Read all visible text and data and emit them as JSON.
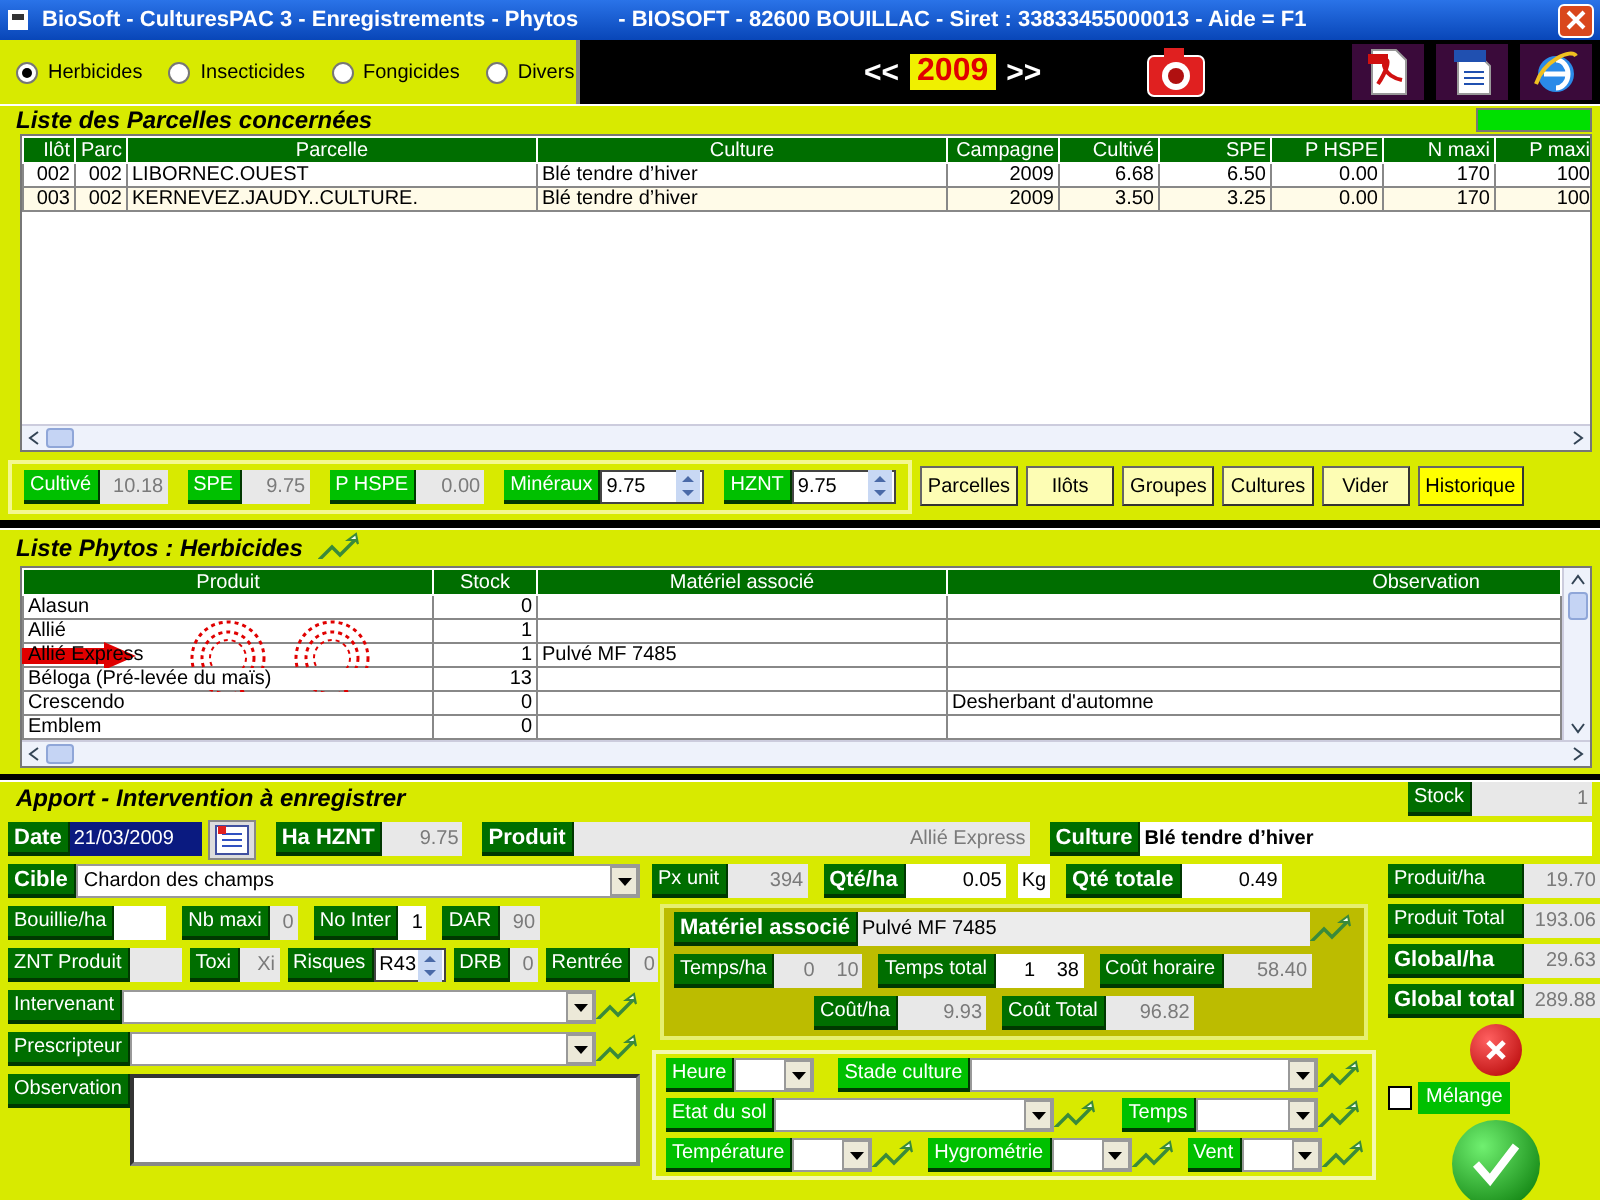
{
  "window": {
    "title": [
      "BioSoft - CulturesPAC 3 - Enregistrements - Phytos",
      "- BIOSOFT - 82600 BOUILLAC - Siret : 33833455000013 - Aide = F1"
    ]
  },
  "filters": [
    {
      "label": "Herbicides",
      "selected": true
    },
    {
      "label": "Insecticides",
      "selected": false
    },
    {
      "label": "Fongicides",
      "selected": false
    },
    {
      "label": "Divers",
      "selected": false
    }
  ],
  "year": {
    "prev": "<<",
    "value": "2009",
    "next": ">>"
  },
  "parcelles": {
    "title": "Liste des Parcelles concernées",
    "columns": [
      "Ilôt",
      "Parc",
      "Parcelle",
      "Culture",
      "Campagne",
      "Cultivé",
      "SPE",
      "P HSPE",
      "N maxi",
      "P maxi"
    ],
    "rows": [
      [
        "002",
        "002",
        "LIBORNEC.OUEST",
        "Blé tendre d’hiver",
        "2009",
        "6.68",
        "6.50",
        "0.00",
        "170",
        "100"
      ],
      [
        "003",
        "002",
        "KERNEVEZ.JAUDY..CULTURE.",
        "Blé tendre d’hiver",
        "2009",
        "3.50",
        "3.25",
        "0.00",
        "170",
        "100"
      ]
    ]
  },
  "summary": {
    "fields": [
      {
        "label": "Cultivé",
        "value": "10.18",
        "kind": "readonly"
      },
      {
        "label": "SPE",
        "value": "9.75",
        "kind": "readonly"
      },
      {
        "label": "P HSPE",
        "value": "0.00",
        "kind": "readonly"
      },
      {
        "label": "Minéraux",
        "value": "9.75",
        "kind": "spin"
      },
      {
        "label": "HZNT",
        "value": "9.75",
        "kind": "spin"
      }
    ],
    "buttons": [
      {
        "label": "Parcelles",
        "highlighted": false
      },
      {
        "label": "Ilôts",
        "highlighted": false
      },
      {
        "label": "Groupes",
        "highlighted": false
      },
      {
        "label": "Cultures",
        "highlighted": false
      },
      {
        "label": "Vider",
        "highlighted": false
      },
      {
        "label": "Historique",
        "highlighted": true
      }
    ]
  },
  "phytos": {
    "title": "Liste Phytos : Herbicides",
    "columns": [
      "Produit",
      "Stock",
      "Matériel associé",
      "Observation"
    ],
    "rows": [
      {
        "produit": "Alasun",
        "stock": "0",
        "marked": false
      },
      {
        "produit": "Allié",
        "stock": "1",
        "marked": false
      },
      {
        "produit": "Allié Express",
        "stock": "1",
        "materiel": "Pulvé MF 7485",
        "marked": true
      },
      {
        "produit": "Béloga (Pré-levée du maïs)",
        "stock": "13",
        "marked": false
      },
      {
        "produit": "Crescendo",
        "stock": "0",
        "observation": "Desherbant d'automne",
        "marked": false
      },
      {
        "produit": "Emblem",
        "stock": "0",
        "marked": false
      }
    ]
  },
  "apport": {
    "title": "Apport - Intervention à enregistrer",
    "stock": {
      "label": "Stock",
      "value": "1",
      "kind": "readonly",
      "bold": false
    },
    "head": [
      {
        "label": "Date",
        "value": "21/03/2009",
        "kind": "date",
        "bold": true
      },
      {
        "label": "Ha HZNT",
        "value": "9.75",
        "kind": "readonly",
        "bold": true
      },
      {
        "label": "Produit",
        "value": "Allié Express",
        "kind": "readonly",
        "bold": true
      },
      {
        "label": "Culture",
        "value": "Blé tendre d’hiver",
        "kind": "input",
        "bold": true
      }
    ],
    "left": [
      [
        {
          "label": "Cible",
          "value": "Chardon des champs",
          "kind": "select",
          "bold": true
        }
      ],
      [
        {
          "label": "Bouillie/ha",
          "kind": "input",
          "bold": false
        },
        {
          "label": "Nb maxi",
          "value": "0",
          "kind": "readonly",
          "bold": false
        },
        {
          "label": "No Inter",
          "value": "1",
          "kind": "input",
          "bold": false
        },
        {
          "label": "DAR",
          "value": "90",
          "kind": "readonly",
          "bold": false
        }
      ],
      [
        {
          "label": "ZNT Produit",
          "kind": "readonly",
          "bold": false
        },
        {
          "label": "Toxi",
          "value": "Xi",
          "kind": "readonly",
          "bold": false
        },
        {
          "label": "Risques",
          "value": "R43",
          "kind": "spin",
          "bold": false
        },
        {
          "label": "DRB",
          "value": "0",
          "kind": "readonly",
          "bold": false
        },
        {
          "label": "Rentrée",
          "value": "0",
          "kind": "readonly",
          "bold": false
        }
      ],
      [
        {
          "label": "Intervenant",
          "kind": "picker",
          "bold": false
        }
      ],
      [
        {
          "label": "Prescripteur",
          "kind": "picker",
          "bold": false
        }
      ],
      [
        {
          "label": "Observation",
          "kind": "textarea",
          "bold": false
        }
      ]
    ],
    "pricing": [
      {
        "label": "Px unit",
        "value": "394",
        "kind": "readonly",
        "bold": false
      },
      {
        "label": "Qté/ha",
        "value": "0.05",
        "unit": "Kg",
        "kind": "input",
        "bold": true
      },
      {
        "label": "Qté totale",
        "value": "0.49",
        "kind": "input",
        "bold": true
      }
    ],
    "materiel": {
      "label": "Matériel associé",
      "value": "Pulvé MF 7485",
      "rows": [
        [
          {
            "label": "Temps/ha",
            "values": [
              "0",
              "10"
            ],
            "kind": "readonly",
            "bold": false
          },
          {
            "label": "Temps total",
            "values": [
              "1",
              "38"
            ],
            "kind": "input",
            "bold": false
          },
          {
            "label": "Coût horaire",
            "values": [
              "58.40"
            ],
            "kind": "readonly",
            "bold": false
          }
        ],
        [
          {
            "label": "Coût/ha",
            "values": [
              "9.93"
            ],
            "kind": "readonly",
            "bold": false
          },
          {
            "label": "Coût Total",
            "values": [
              "96.82"
            ],
            "kind": "readonly",
            "bold": false
          }
        ]
      ]
    },
    "conditions": [
      [
        {
          "label": "Heure",
          "kind": "select",
          "bold": false
        },
        {
          "label": "Stade culture",
          "kind": "picker",
          "bold": false
        }
      ],
      [
        {
          "label": "Etat du sol",
          "kind": "picker",
          "bold": false
        },
        {
          "label": "Temps",
          "kind": "picker",
          "bold": false
        }
      ],
      [
        {
          "label": "Température",
          "kind": "picker",
          "bold": false
        },
        {
          "label": "Hygrométrie",
          "kind": "picker",
          "bold": false
        },
        {
          "label": "Vent",
          "kind": "picker",
          "bold": false
        }
      ]
    ],
    "totals": [
      {
        "label": "Produit/ha",
        "value": "19.70",
        "kind": "readonly",
        "bold": false
      },
      {
        "label": "Produit Total",
        "value": "193.06",
        "kind": "readonly",
        "bold": false
      },
      {
        "label": "Global/ha",
        "value": "29.63",
        "kind": "readonly",
        "bold": true
      },
      {
        "label": "Global total",
        "value": "289.88",
        "kind": "readonly",
        "bold": true
      }
    ],
    "melange": {
      "label": "Mélange",
      "checked": false
    }
  }
}
